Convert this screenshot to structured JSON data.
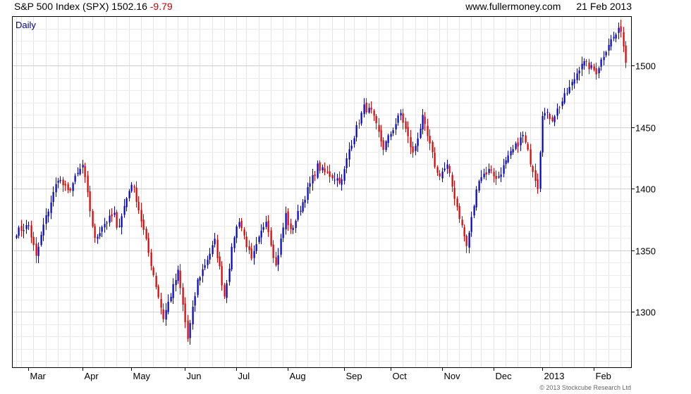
{
  "header": {
    "title": "S&P 500 Index (SPX)",
    "last": "1502.16",
    "change": "-9.79",
    "site": "www.fullermoney.com",
    "date": "21 Feb 2013"
  },
  "footer": {
    "copyright": "© 2013 Stockcube Research Ltd"
  },
  "chart_data": {
    "type": "candlestick",
    "title": "S&P 500 Index (SPX)",
    "interval_label": "Daily",
    "x_tick_labels": [
      "Mar",
      "Apr",
      "May",
      "Jun",
      "Jul",
      "Aug",
      "Sep",
      "Oct",
      "Nov",
      "Dec",
      "2013",
      "Feb"
    ],
    "y_ticks": [
      1300,
      1350,
      1400,
      1450,
      1500
    ],
    "ylim": [
      1255,
      1540
    ],
    "y_axis_position": "right",
    "grid": true,
    "colors": {
      "up": "#0000cc",
      "down": "#dd0000",
      "grid": "#dddddd",
      "axis_text": "#000000",
      "label": "#000080"
    },
    "anchors": [
      [
        "2012-02-23",
        1365
      ],
      [
        "2012-03-01",
        1370
      ],
      [
        "2012-03-06",
        1344
      ],
      [
        "2012-03-09",
        1370
      ],
      [
        "2012-03-19",
        1409
      ],
      [
        "2012-03-23",
        1397
      ],
      [
        "2012-04-02",
        1419
      ],
      [
        "2012-04-10",
        1358
      ],
      [
        "2012-04-13",
        1370
      ],
      [
        "2012-04-20",
        1379
      ],
      [
        "2012-04-23",
        1366
      ],
      [
        "2012-05-01",
        1405
      ],
      [
        "2012-05-03",
        1392
      ],
      [
        "2012-05-18",
        1295
      ],
      [
        "2012-05-24",
        1320
      ],
      [
        "2012-05-29",
        1332
      ],
      [
        "2012-06-04",
        1278
      ],
      [
        "2012-06-08",
        1325
      ],
      [
        "2012-06-19",
        1357
      ],
      [
        "2012-06-25",
        1313
      ],
      [
        "2012-06-29",
        1362
      ],
      [
        "2012-07-03",
        1375
      ],
      [
        "2012-07-11",
        1341
      ],
      [
        "2012-07-19",
        1376
      ],
      [
        "2012-07-25",
        1337
      ],
      [
        "2012-07-31",
        1379
      ],
      [
        "2012-08-02",
        1365
      ],
      [
        "2012-08-17",
        1418
      ],
      [
        "2012-08-22",
        1413
      ],
      [
        "2012-08-31",
        1406
      ],
      [
        "2012-09-06",
        1432
      ],
      [
        "2012-09-14",
        1466
      ],
      [
        "2012-09-19",
        1462
      ],
      [
        "2012-09-26",
        1433
      ],
      [
        "2012-10-05",
        1461
      ],
      [
        "2012-10-12",
        1428
      ],
      [
        "2012-10-18",
        1457
      ],
      [
        "2012-10-26",
        1412
      ],
      [
        "2012-10-31",
        1412
      ],
      [
        "2012-11-05",
        1418
      ],
      [
        "2012-11-15",
        1353
      ],
      [
        "2012-11-23",
        1409
      ],
      [
        "2012-11-30",
        1416
      ],
      [
        "2012-12-04",
        1407
      ],
      [
        "2012-12-12",
        1428
      ],
      [
        "2012-12-19",
        1443
      ],
      [
        "2012-12-28",
        1402
      ],
      [
        "2013-01-02",
        1462
      ],
      [
        "2013-01-08",
        1457
      ],
      [
        "2013-01-18",
        1485
      ],
      [
        "2013-01-25",
        1503
      ],
      [
        "2013-02-04",
        1495
      ],
      [
        "2013-02-11",
        1518
      ],
      [
        "2013-02-19",
        1530
      ],
      [
        "2013-02-21",
        1502
      ]
    ]
  }
}
